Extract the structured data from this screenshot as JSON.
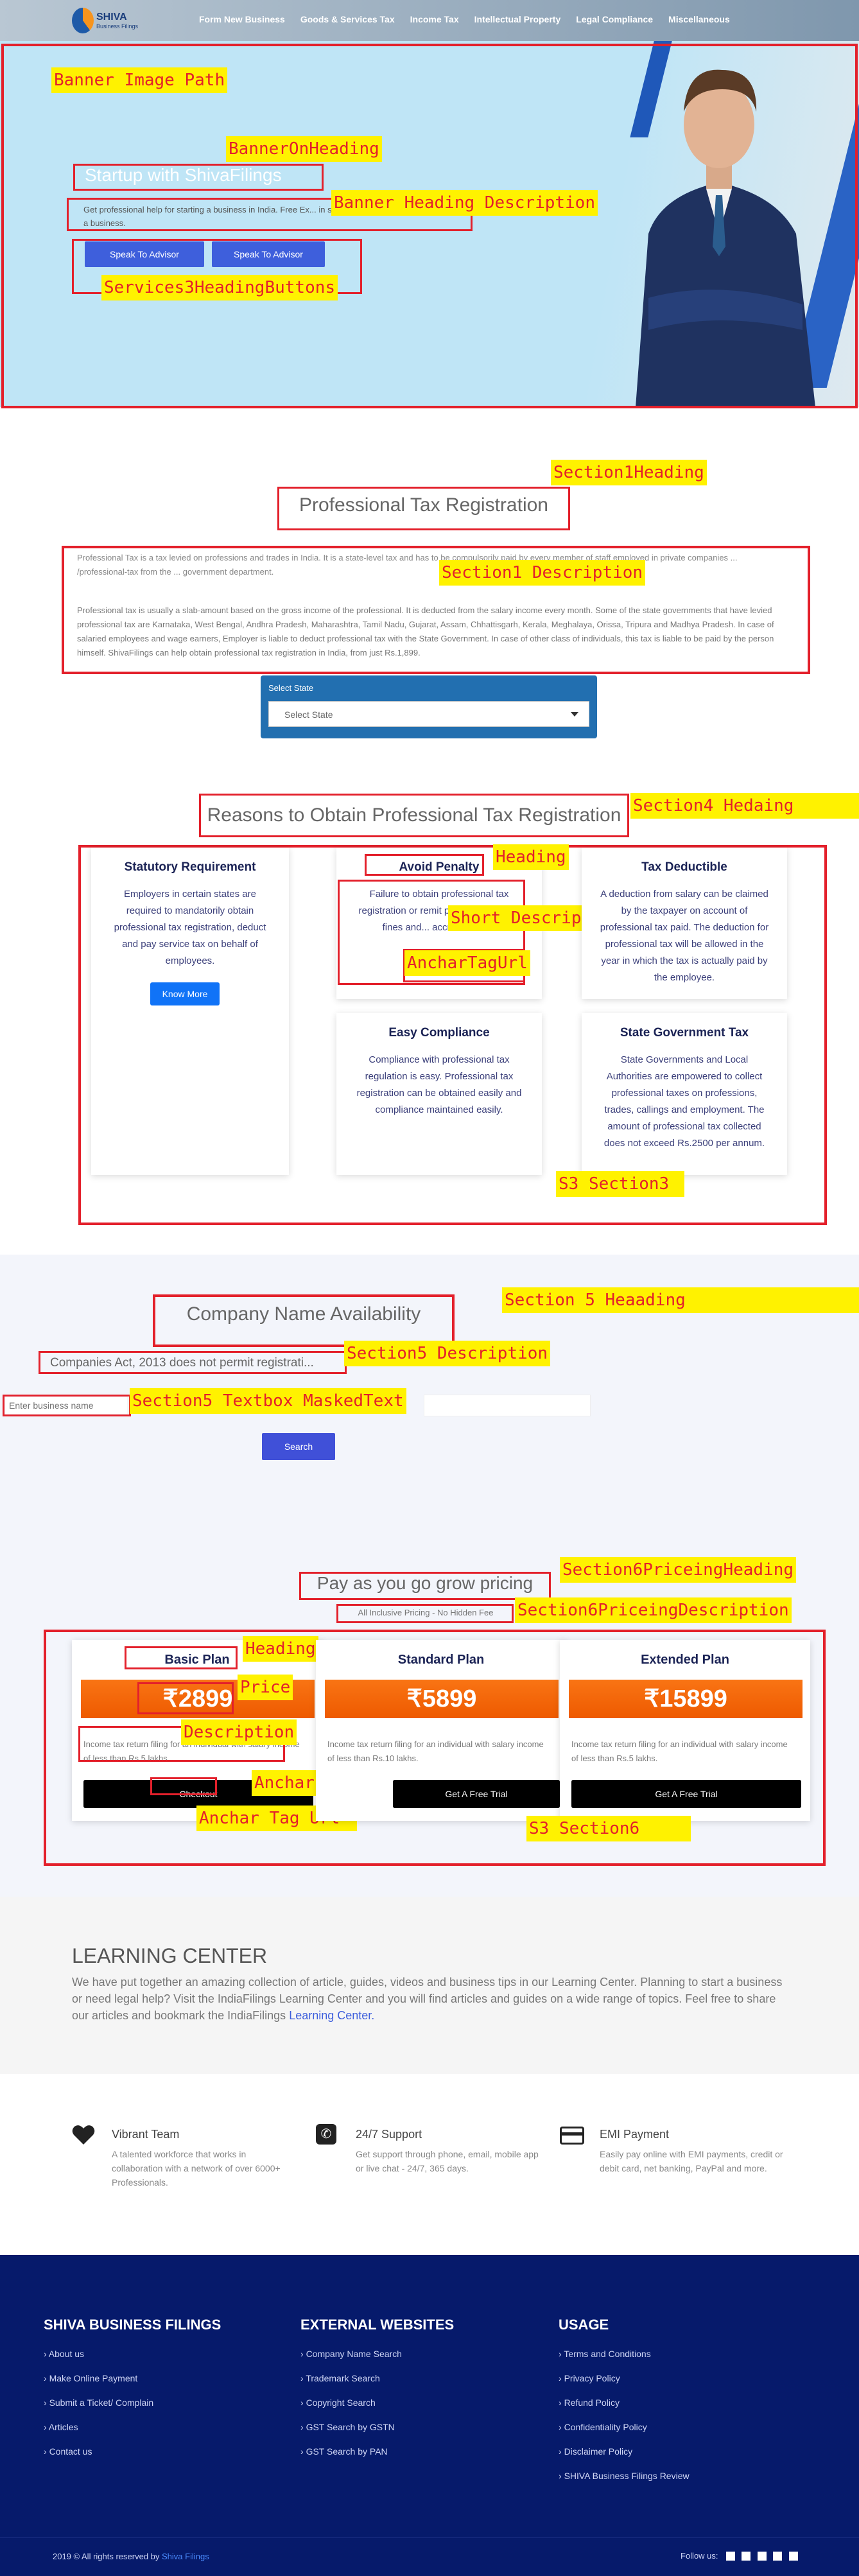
{
  "header": {
    "logo_title": "SHIVA",
    "logo_sub": "Business Filings",
    "nav": [
      "Form New Business",
      "Goods & Services Tax",
      "Income Tax",
      "Intellectual Property",
      "Legal Compliance",
      "Miscellaneous"
    ]
  },
  "banner": {
    "label_image": "Banner Image Path",
    "label_heading": "BannerOnHeading",
    "heading": "Startup with ShivaFilings",
    "label_desc": "Banner Heading Description",
    "desc": "Get professional help for starting a business in India. Free Ex... in starting a business.",
    "btn1": "Speak To Advisor",
    "btn2": "Speak To Advisor",
    "label_buttons": "Services3HeadingButtons"
  },
  "section1": {
    "label_heading": "Section1Heading",
    "title": "Professional Tax Registration",
    "label_desc": "Section1 Description",
    "p1": "Professional Tax is a tax levied on professions and trades in India. It is a state-level tax and has to be compulsorily paid by every member of staff employed in private companies ... /professional-tax from the ... government department.",
    "p2": "Professional tax is usually a slab-amount based on the gross income of the professional. It is deducted from the salary income every month. Some of the state governments that have levied professional tax are Karnataka, West Bengal, Andhra Pradesh, Maharashtra, Tamil Nadu, Gujarat, Assam, Chhattisgarh, Kerala, Meghalaya, Orissa, Tripura and Madhya Pradesh. In case of salaried employees and wage earners, Employer is liable to deduct professional tax with the State Government. In case of other class of individuals, this tax is liable to be paid by the person himself. ShivaFilings can help obtain professional tax registration in India, from just Rs.1,899.",
    "select_label": "Select State",
    "select_value": "Select State"
  },
  "section4": {
    "title": "Reasons to Obtain Professional Tax Registration",
    "label_heading": "Section4 Hedaing",
    "label_card_heading": "Heading",
    "label_short": "Short Description",
    "label_anchor": "AncharTagUrl",
    "label_section": "S3 Section3",
    "cards": [
      {
        "title": "Statutory Requirement",
        "text": "Employers in certain states are required to mandatorily obtain professional tax registration, deduct and pay service tax on behalf of employees.",
        "btn": "Know More"
      },
      {
        "title": "Avoid Penalty",
        "text": "Failure to obtain professional tax registration or remit p... could result in fines and... accrue over t..."
      },
      {
        "title": "Tax Deductible",
        "text": "A deduction from salary can be claimed by the taxpayer on account of professional tax paid. The deduction for professional tax will be allowed in the year in which the tax is actually paid by the employee."
      },
      {
        "title": "Easy Compliance",
        "text": "Compliance with professional tax regulation is easy. Professional tax registration can be obtained easily and compliance maintained easily."
      },
      {
        "title": "State Government Tax",
        "text": "State Governments and Local Authorities are empowered to collect professional taxes on professions, trades, callings and employment. The amount of professional tax collected does not exceed Rs.2500 per annum."
      }
    ]
  },
  "section5": {
    "title": "Company Name Availability",
    "label_heading": "Section 5 Heaading",
    "desc": "Companies Act, 2013 does not permit registrati...",
    "label_desc": "Section5 Description",
    "placeholder": "Enter business name",
    "label_textbox": "Section5 Textbox MaskedText",
    "search": "Search"
  },
  "section6": {
    "title": "Pay as you go grow pricing",
    "label_heading": "Section6PriceingHeading",
    "desc": "All Inclusive Pricing - No Hidden Fee",
    "label_desc": "Section6PriceingDescription",
    "label_card_heading": "Heading",
    "label_price": "Price",
    "label_description": "Description",
    "label_anchor_title": "Anchar Tag Title",
    "label_anchor_url": "Anchar Tag Url",
    "label_section": "S3 Section6",
    "plans": [
      {
        "title": "Basic Plan",
        "price": "₹2899",
        "desc": "Income tax return filing for an individual with salary income of less than Rs.5 lakhs.",
        "btn": "Checkout"
      },
      {
        "title": "Standard Plan",
        "price": "₹5899",
        "desc": "Income tax return filing for an individual with salary income of less than Rs.10 lakhs.",
        "btn": "Get A Free Trial"
      },
      {
        "title": "Extended Plan",
        "price": "₹15899",
        "desc": "Income tax return filing for an individual with salary income of less than Rs.5 lakhs.",
        "btn": "Get A Free Trial"
      }
    ]
  },
  "learning": {
    "title": "LEARNING CENTER",
    "text": "We have put together an amazing collection of article, guides, videos and business tips in our Learning Center. Planning to start a business or need legal help? Visit the IndiaFilings Learning Center and you will find articles and guides on a wide range of topics. Feel free to share our articles and bookmark the IndiaFilings",
    "link": "Learning Center."
  },
  "features": [
    {
      "title": "Vibrant Team",
      "text": "A talented workforce that works in collaboration with a network of over 6000+ Professionals."
    },
    {
      "title": "24/7 Support",
      "text": "Get support through phone, email, mobile app or live chat - 24/7, 365 days."
    },
    {
      "title": "EMI Payment",
      "text": "Easily pay online with EMI payments, credit or debit card, net banking, PayPal and more."
    }
  ],
  "footer": {
    "col1": {
      "title": "SHIVA BUSINESS FILINGS",
      "links": [
        "About us",
        "Make Online Payment",
        "Submit a Ticket/ Complain",
        "Articles",
        "Contact us"
      ]
    },
    "col2": {
      "title": "EXTERNAL WEBSITES",
      "links": [
        "Company Name Search",
        "Trademark Search",
        "Copyright Search",
        "GST Search by GSTN",
        "GST Search by PAN"
      ]
    },
    "col3": {
      "title": "USAGE",
      "links": [
        "Terms and Conditions",
        "Privacy Policy",
        "Refund Policy",
        "Confidentiality Policy",
        "Disclaimer Policy",
        "SHIVA Business Filings Review"
      ]
    },
    "copyright": "2019 © All rights reserved by",
    "copyright_link": "Shiva Filings",
    "follow": "Follow us:"
  },
  "colors": {
    "accent": "#3e5fdc",
    "orange": "#f97414",
    "navy": "#061a6b",
    "annot_red": "#e3202b",
    "annot_yellow": "#fff200"
  }
}
